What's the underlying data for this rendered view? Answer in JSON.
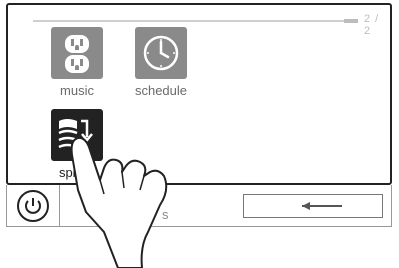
{
  "pager": {
    "indicator": "2 / 2"
  },
  "apps": [
    {
      "label": "music",
      "icon": "outlet-icon",
      "tile_color": "#8a8a8a"
    },
    {
      "label": "schedule",
      "icon": "clock-icon",
      "tile_color": "#8a8a8a"
    },
    {
      "label": "spillov",
      "icon": "spillover-icon",
      "tile_color": "#222222"
    }
  ],
  "bottom": {
    "partial_text": "s",
    "power_icon": "power-icon",
    "back_icon": "arrow-left-icon"
  },
  "overlay": {
    "icon": "pointing-hand-icon"
  },
  "colors": {
    "frame": "#222222",
    "tile_gray": "#8a8a8a",
    "tile_dark": "#222222",
    "label": "#6a6a6a"
  }
}
